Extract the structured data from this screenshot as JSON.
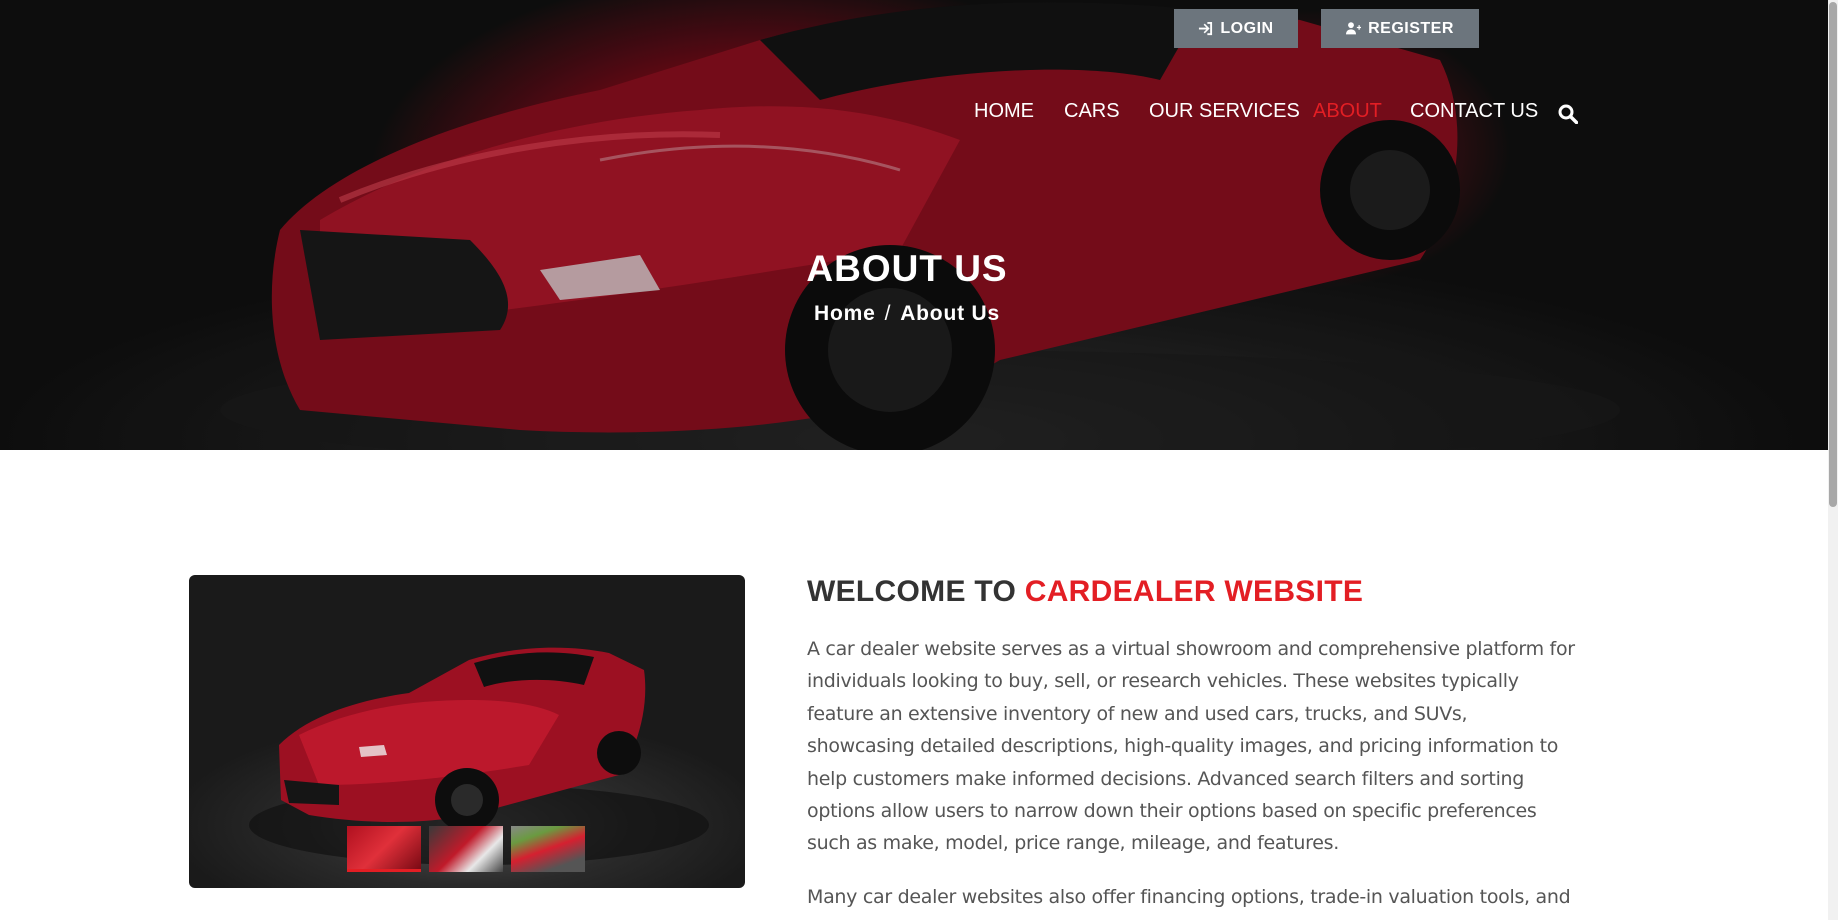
{
  "auth": {
    "login_label": "LOGIN",
    "register_label": "REGISTER"
  },
  "nav": {
    "items": [
      {
        "label": "HOME"
      },
      {
        "label": "CARS"
      },
      {
        "label": "OUR SERVICES"
      },
      {
        "label": "ABOUT",
        "active": true
      },
      {
        "label": "CONTACT US"
      }
    ],
    "search_icon": "search-icon"
  },
  "hero": {
    "title": "ABOUT US",
    "breadcrumb": {
      "home": "Home",
      "separator": "/",
      "current": "About Us"
    }
  },
  "about": {
    "heading_prefix": "WELCOME TO",
    "heading_accent": "CARDEALER WEBSITE",
    "paragraph1": "A car dealer website serves as a virtual showroom and comprehensive platform for individuals looking to buy, sell, or research vehicles. These websites typically feature an extensive inventory of new and used cars, trucks, and SUVs, showcasing detailed descriptions, high-quality images, and pricing information to help customers make informed decisions. Advanced search filters and sorting options allow users to narrow down their options based on specific preferences such as make, model, price range, mileage, and features.",
    "paragraph2": "Many car dealer websites also offer financing options, trade-in valuation tools, and"
  },
  "colors": {
    "accent": "#e31e24",
    "button_gray": "#6c757d",
    "heading": "#333333",
    "body_text": "#555555"
  }
}
